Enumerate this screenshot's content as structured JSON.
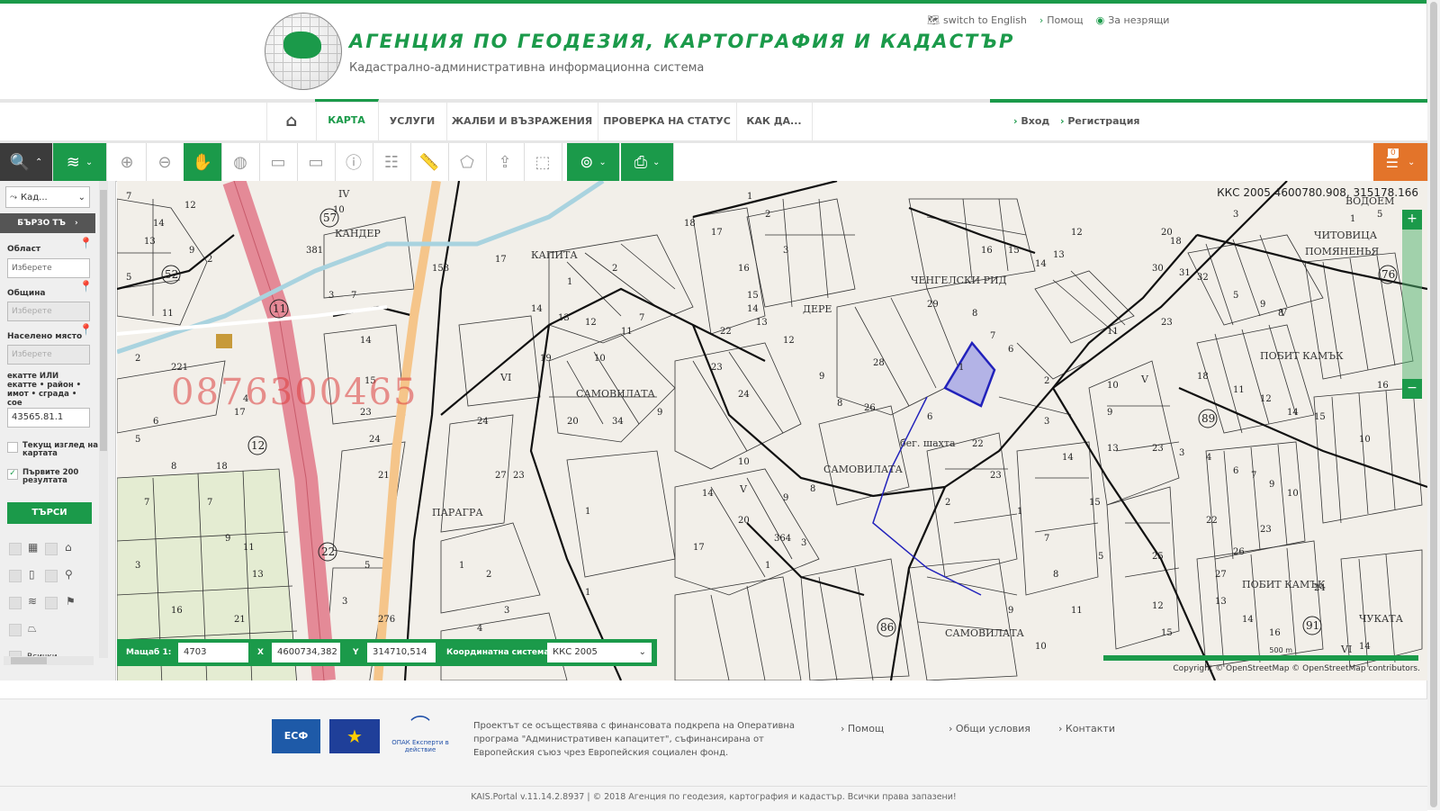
{
  "header": {
    "agency_title": "АГЕНЦИЯ ПО ГЕОДЕЗИЯ, КАРТОГРАФИЯ И КАДАСТЪР",
    "agency_subtitle": "Кадастрално-административна информационна система",
    "links": {
      "english": "switch to English",
      "help": "Помощ",
      "visually_impaired": "За незрящи"
    }
  },
  "nav": {
    "items": [
      "КАРТА",
      "УСЛУГИ",
      "ЖАЛБИ И ВЪЗРАЖЕНИЯ",
      "ПРОВЕРКА НА СТАТУС",
      "КАК ДА..."
    ],
    "login": "Вход",
    "register": "Регистрация"
  },
  "toolbar": {
    "cart_count": "0"
  },
  "panel": {
    "layer": "Кад...",
    "quick_search": "БЪРЗО ТЪ",
    "region_label": "Област",
    "region_placeholder": "Изберете",
    "municipality_label": "Община",
    "municipality_placeholder": "Изберете",
    "settlement_label": "Населено място",
    "settlement_placeholder": "Изберете",
    "ekatte_label": "екатте ИЛИ екатте • район • имот • сграда • сое",
    "ekatte_value": "43565.81.1",
    "current_view_label": "Текущ изглед на картата",
    "first200_label": "Първите 200 резултата",
    "search_button": "ТЪРСИ",
    "all_label": "Всички"
  },
  "map": {
    "coordinates": "ККС 2005 4600780.908, 315178.166",
    "phone_watermark": "0876300465",
    "scale_label": "Мащаб 1:",
    "scale_value": "4703",
    "x_label": "X",
    "x_value": "4600734,382",
    "y_label": "Y",
    "y_value": "314710,514",
    "crs_label": "Координатна система",
    "crs_value": "ККС 2005",
    "scalebar_text": "500 m",
    "copyright": "Copyright © OpenStreetMap © OpenStreetMap contributors.",
    "places": [
      "КАНДЕР",
      "КАПИТА",
      "ЧЕНГЕЛСКИ РИД",
      "ДЕРЕ",
      "САМОВИЛАТА",
      "САМОВИЛАТА",
      "ПАРАГРА",
      "бег. шахта",
      "ПОБИТ КАМЪК",
      "ПОБИТ КАМЪК",
      "ЧИТОВИЦА",
      "ПОМЯНЕНЬЯ",
      "ВОДОЕМ",
      "ЧУКАТА",
      "САМОВИЛАТА",
      "VI",
      "IV",
      "V",
      "V",
      "VI",
      "V"
    ],
    "circle_numbers": [
      "57",
      "52",
      "11",
      "12",
      "22",
      "86",
      "89",
      "91",
      "76"
    ]
  },
  "footer": {
    "project_text": "Проектът се осъществява с финансовата подкрепа на Оперативна програма \"Административен капацитет\", съфинансирана от Европейския съюз чрез Европейския социален фонд.",
    "esf_logo": "ЕСФ",
    "opak_logo": "ОПАК Експерти в действие",
    "links": [
      "Помощ",
      "Общи условия",
      "Контакти"
    ],
    "copyright": "KAIS.Portal v.11.14.2.8937 | © 2018 Агенция по геодезия, картография и кадастър. Всички права запазени!"
  },
  "colors": {
    "brand_green": "#1b9a4a",
    "highway": "#e48a97",
    "road": "#f5c58a",
    "river": "#a9d3df",
    "parcel_highlight": "#b3b3e6"
  }
}
